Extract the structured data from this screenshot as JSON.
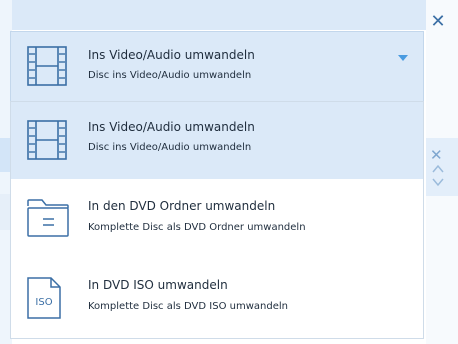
{
  "selected": {
    "title": "Ins Video/Audio umwandeln",
    "subtitle": "Disc ins Video/Audio umwandeln",
    "icon": "film-strip-icon"
  },
  "options": [
    {
      "title": "Ins Video/Audio umwandeln",
      "subtitle": "Disc ins Video/Audio umwandeln",
      "icon": "film-strip-icon",
      "selected": true
    },
    {
      "title": "In den DVD Ordner umwandeln",
      "subtitle": "Komplette Disc als DVD Ordner umwandeln",
      "icon": "folder-icon",
      "selected": false
    },
    {
      "title": "In DVD ISO umwandeln",
      "subtitle": "Komplette Disc als DVD ISO umwandeln",
      "icon": "iso-file-icon",
      "icon_text": "ISO",
      "selected": false
    }
  ],
  "colors": {
    "accent": "#3b6fa5",
    "selected_bg": "#dbe9f8",
    "dropdown_arrow": "#4a9be0"
  }
}
